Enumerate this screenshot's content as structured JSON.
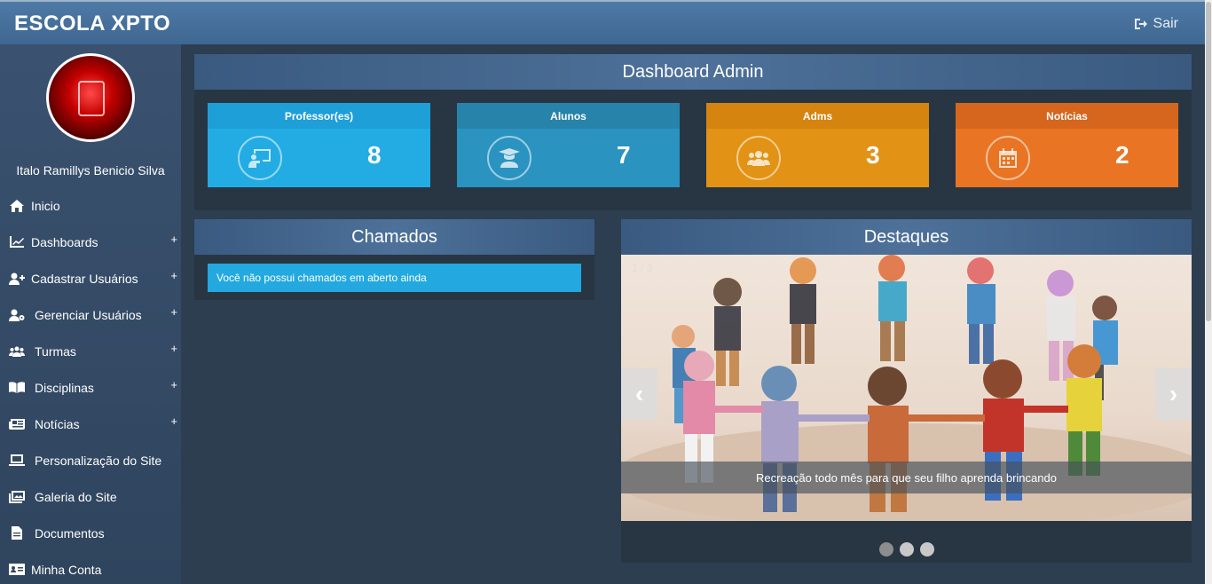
{
  "header": {
    "brand": "ESCOLA XPTO",
    "logout_label": "Sair"
  },
  "sidebar": {
    "username": "Italo Ramillys Benicio Silva",
    "items": [
      {
        "label": "Inicio",
        "icon": "home-icon",
        "expandable": false
      },
      {
        "label": "Dashboards",
        "icon": "chart-icon",
        "expandable": true
      },
      {
        "label": "Cadastrar Usuários",
        "icon": "user-plus-icon",
        "expandable": true
      },
      {
        "label": "Gerenciar Usuários",
        "icon": "user-cog-icon",
        "expandable": true
      },
      {
        "label": "Turmas",
        "icon": "users-icon",
        "expandable": true
      },
      {
        "label": "Disciplinas",
        "icon": "book-icon",
        "expandable": true
      },
      {
        "label": "Notícias",
        "icon": "newspaper-icon",
        "expandable": true
      },
      {
        "label": "Personalização do Site",
        "icon": "laptop-icon",
        "expandable": false
      },
      {
        "label": "Galeria do Site",
        "icon": "images-icon",
        "expandable": false
      },
      {
        "label": "Documentos",
        "icon": "file-icon",
        "expandable": false
      },
      {
        "label": "Minha Conta",
        "icon": "id-card-icon",
        "expandable": false
      }
    ],
    "plus_symbol": "+"
  },
  "dashboard": {
    "title": "Dashboard Admin",
    "cards": [
      {
        "title": "Professor(es)",
        "count": "8",
        "icon": "teacher-icon",
        "head_color": "#1e9fd8",
        "body_color": "#22ace3"
      },
      {
        "title": "Alunos",
        "count": "7",
        "icon": "graduate-icon",
        "head_color": "#2883aa",
        "body_color": "#2a93c0"
      },
      {
        "title": "Adms",
        "count": "3",
        "icon": "users-icon",
        "head_color": "#d4840f",
        "body_color": "#e29215"
      },
      {
        "title": "Notícias",
        "count": "2",
        "icon": "calendar-icon",
        "head_color": "#d6661e",
        "body_color": "#e87424"
      }
    ]
  },
  "chamados": {
    "title": "Chamados",
    "message": "Você não possui chamados em aberto ainda"
  },
  "destaques": {
    "title": "Destaques",
    "slide_counter": "1 / 3",
    "caption": "Recreação todo mês para que seu filho aprenda brincando",
    "prev_symbol": "‹",
    "next_symbol": "›",
    "slides_total": 3,
    "active_slide": 1
  }
}
